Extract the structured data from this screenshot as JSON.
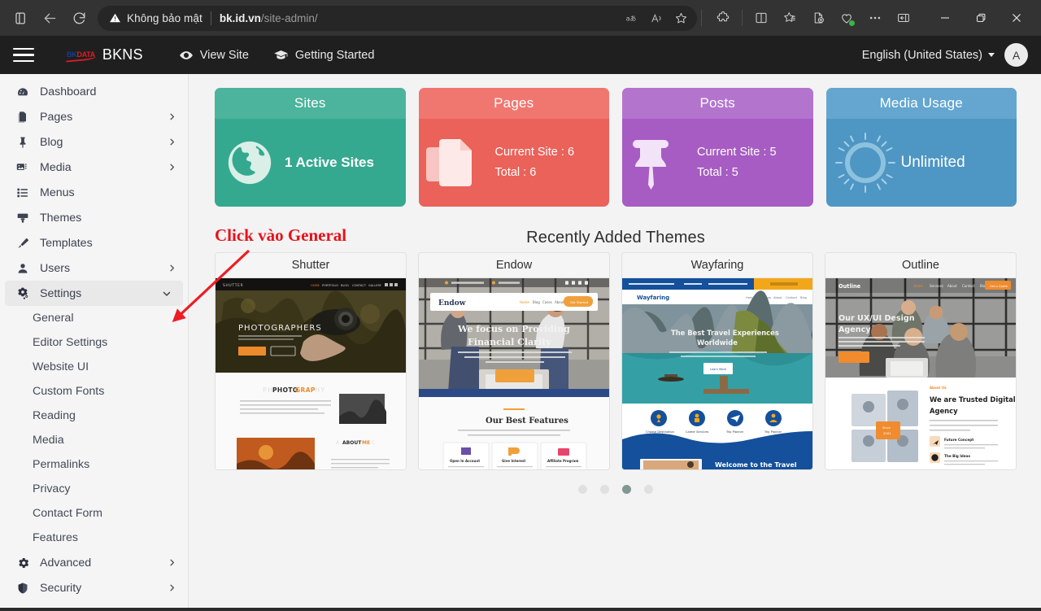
{
  "browser": {
    "security_label": "Không bảo mật",
    "url_host": "bk.id.vn",
    "url_path": "/site-admin/",
    "icons": {
      "tab_overview": "tab-overview-icon",
      "back": "back-arrow-icon",
      "reload": "reload-icon",
      "warning": "warning-triangle-icon",
      "translate": "translate-icon",
      "read_aloud": "read-aloud-icon",
      "favorite": "star-icon",
      "extensions": "extensions-puzzle-icon",
      "split_screen": "split-screen-icon",
      "collections": "collections-icon",
      "add_favorite": "add-favorite-icon",
      "browser_essentials": "browser-essentials-icon",
      "more": "more-ellipsis-icon",
      "sidebar": "sidebar-toggle-icon",
      "minimize": "minimize-icon",
      "restore": "restore-icon",
      "close": "close-icon"
    }
  },
  "header": {
    "menu_toggle": "hamburger-menu-icon",
    "logo_bk": "BK",
    "logo_data": "DATA",
    "brand": "BKNS",
    "view_site": "View Site",
    "getting_started": "Getting Started",
    "language": "English (United States)",
    "avatar_initial": "A"
  },
  "sidebar": {
    "items": [
      {
        "label": "Dashboard",
        "icon": "dashboard-icon",
        "expandable": false
      },
      {
        "label": "Pages",
        "icon": "pages-icon",
        "expandable": true
      },
      {
        "label": "Blog",
        "icon": "blog-pin-icon",
        "expandable": true
      },
      {
        "label": "Media",
        "icon": "media-icon",
        "expandable": true
      },
      {
        "label": "Menus",
        "icon": "menus-list-icon",
        "expandable": false
      },
      {
        "label": "Themes",
        "icon": "themes-brush-icon",
        "expandable": false
      },
      {
        "label": "Templates",
        "icon": "templates-pen-icon",
        "expandable": false
      },
      {
        "label": "Users",
        "icon": "users-person-icon",
        "expandable": true
      },
      {
        "label": "Settings",
        "icon": "settings-gears-icon",
        "expandable": true,
        "active": true
      }
    ],
    "settings_children": [
      "General",
      "Editor Settings",
      "Website UI",
      "Custom Fonts",
      "Reading",
      "Media",
      "Permalinks",
      "Privacy",
      "Contact Form",
      "Features"
    ],
    "bottom_items": [
      {
        "label": "Advanced",
        "icon": "advanced-gear-icon",
        "expandable": true
      },
      {
        "label": "Security",
        "icon": "security-shield-icon",
        "expandable": true
      }
    ]
  },
  "annotation": {
    "text": "Click vào General",
    "color": "#e8121b"
  },
  "stats": [
    {
      "title": "Sites",
      "icon": "globe-icon",
      "lines": [
        "1 Active Sites"
      ],
      "head_color": "#4cb39c",
      "body_color": "#35a98f"
    },
    {
      "title": "Pages",
      "icon": "documents-icon",
      "lines": [
        "Current Site : 6",
        "Total : 6"
      ],
      "head_color": "#f0776f",
      "body_color": "#ea6259"
    },
    {
      "title": "Posts",
      "icon": "pushpin-icon",
      "lines": [
        "Current Site : 5",
        "Total : 5"
      ],
      "head_color": "#b374ce",
      "body_color": "#a65cc2"
    },
    {
      "title": "Media Usage",
      "icon": "usage-gauge-icon",
      "lines": [
        "Unlimited"
      ],
      "head_color": "#64a6cf",
      "body_color": "#4e96c4"
    }
  ],
  "themes_section": {
    "title": "Recently Added Themes",
    "cards": [
      {
        "name": "Shutter",
        "preview": "shutter"
      },
      {
        "name": "Endow",
        "preview": "endow"
      },
      {
        "name": "Wayfaring",
        "preview": "wayfaring"
      },
      {
        "name": "Outline",
        "preview": "outline"
      }
    ],
    "dots": {
      "count": 4,
      "active_index": 2
    }
  }
}
